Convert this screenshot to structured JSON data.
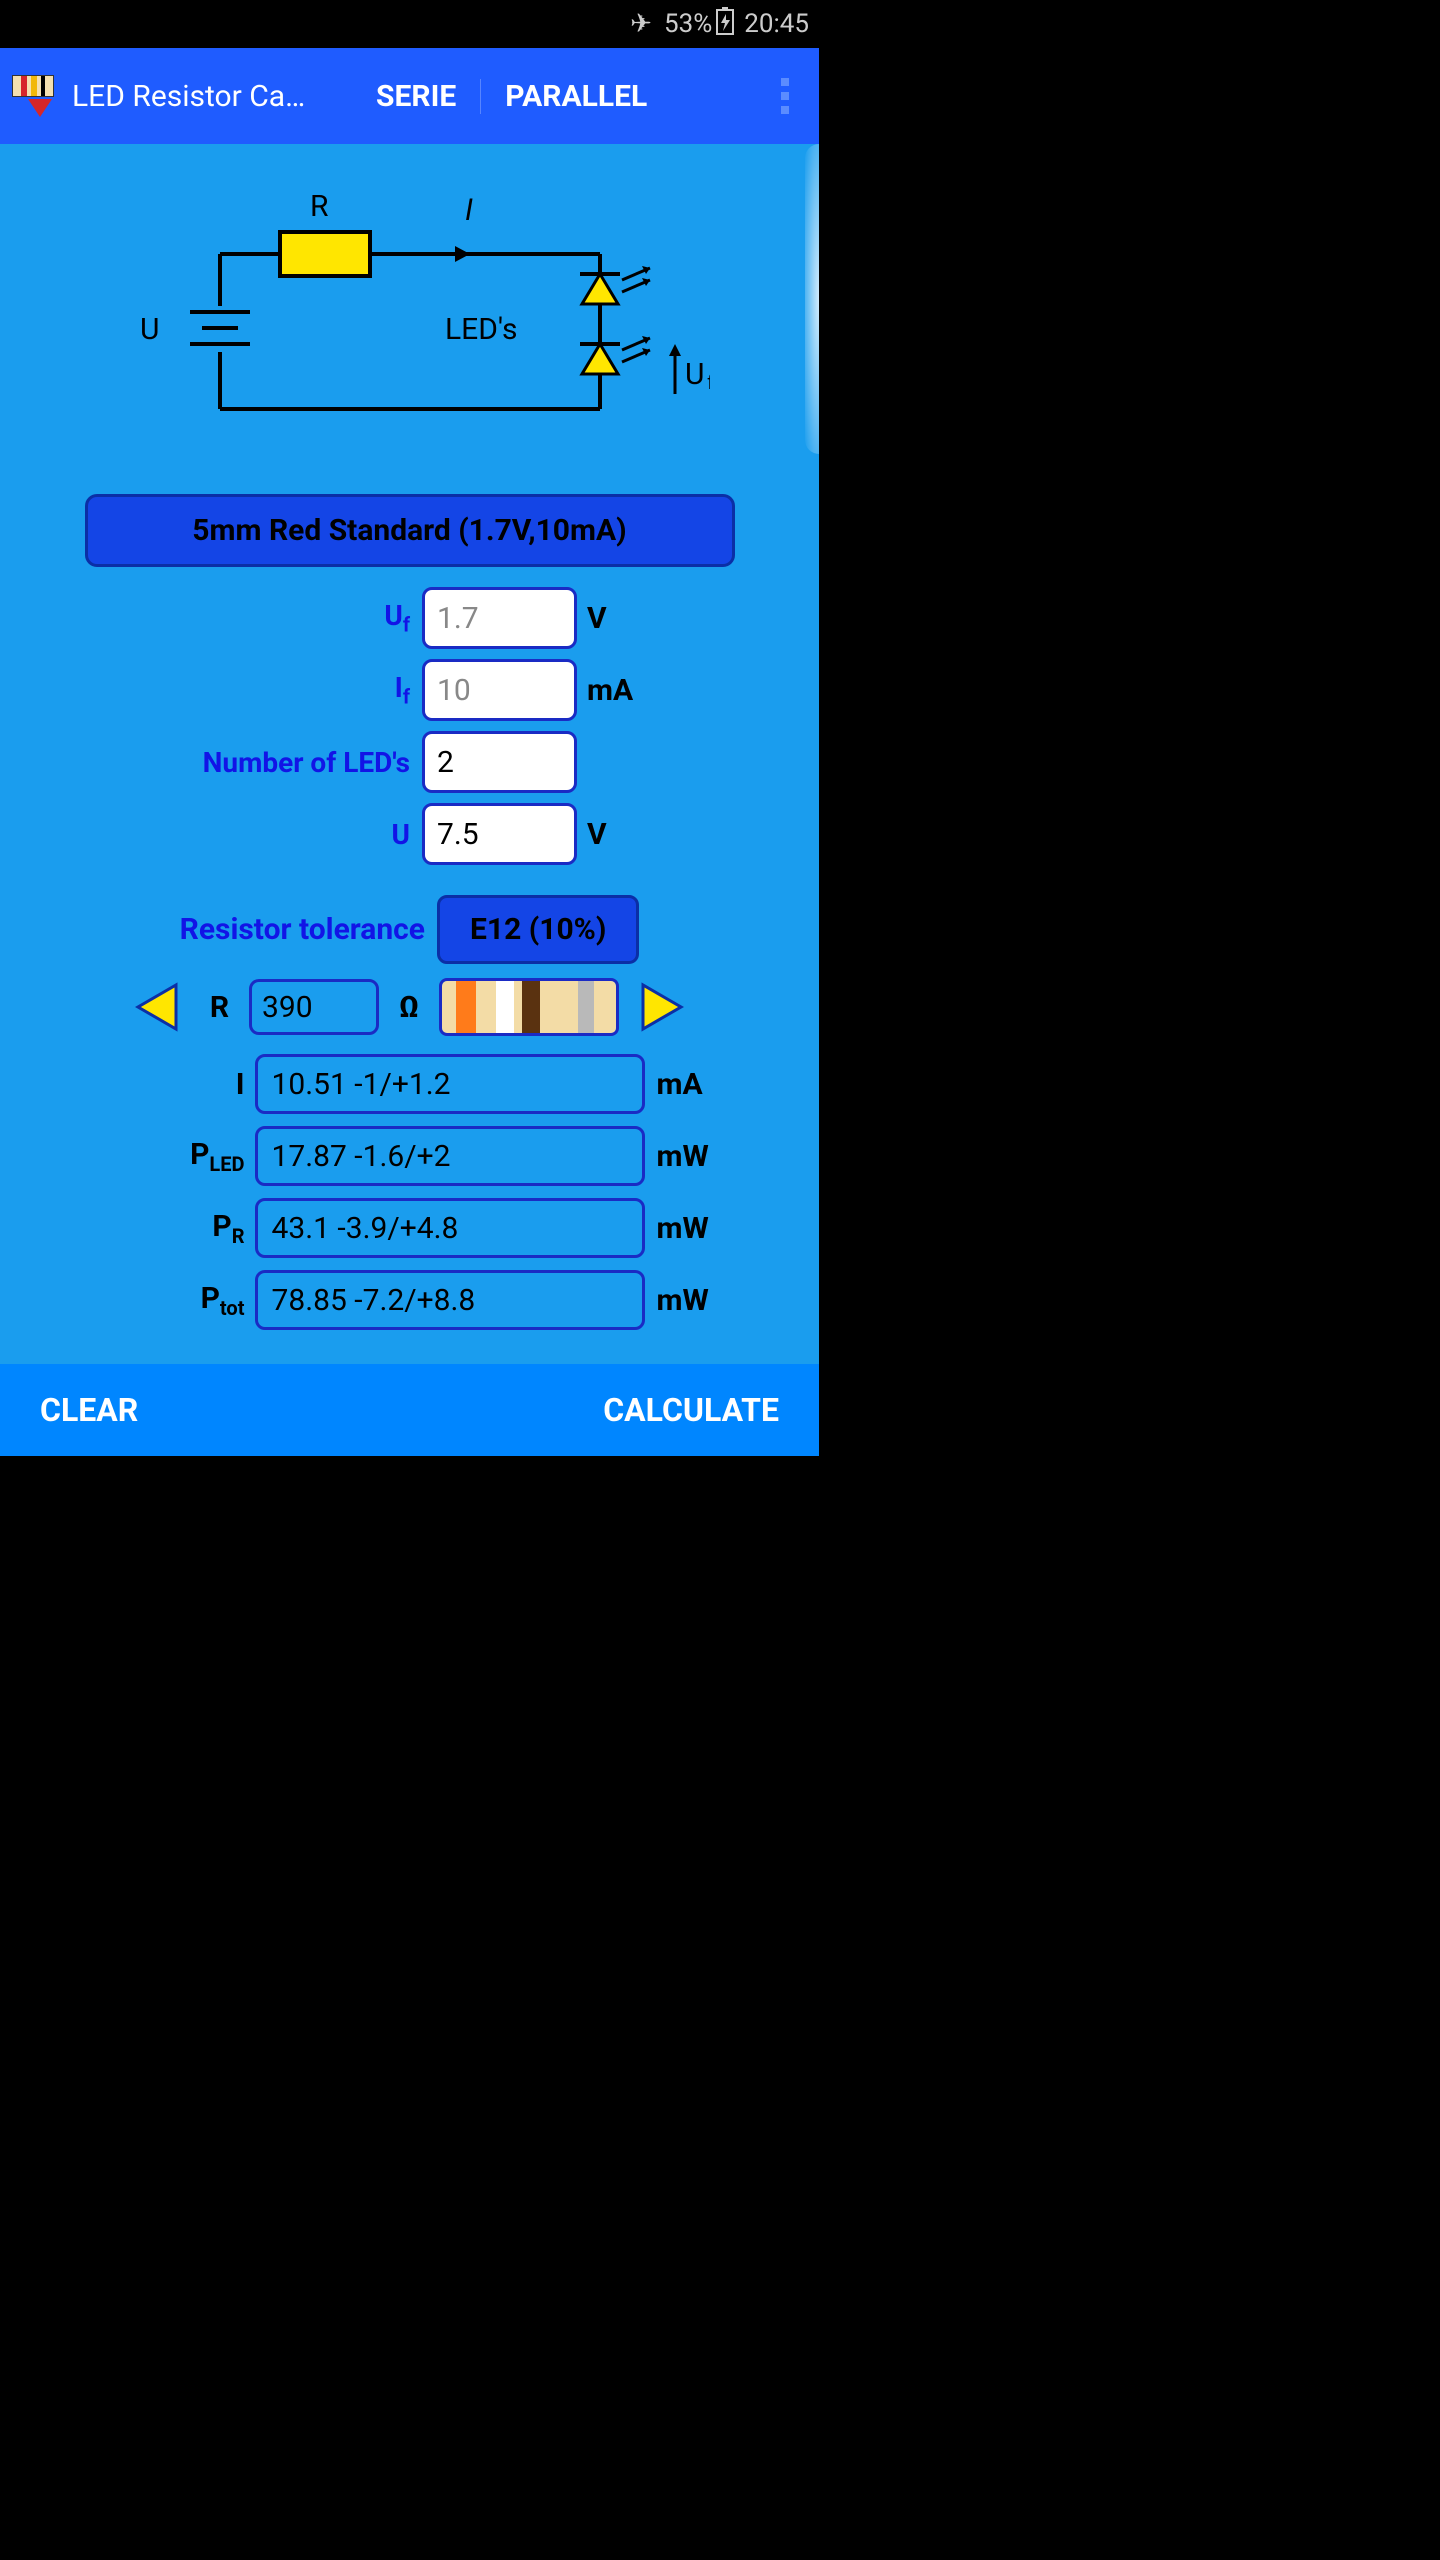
{
  "status": {
    "battery_percent": "53%",
    "time": "20:45"
  },
  "header": {
    "app_title": "LED Resistor Ca…",
    "tabs": [
      "SERIE",
      "PARALLEL"
    ]
  },
  "diagram": {
    "U_label": "U",
    "R_label": "R",
    "I_label": "I",
    "leds_label": "LED's",
    "Uf_label": "Uf"
  },
  "led_type_button": "5mm Red Standard (1.7V,10mA)",
  "inputs": {
    "uf": {
      "label": "Uf",
      "value": "1.7",
      "unit": "V"
    },
    "if": {
      "label": "If",
      "value": "10",
      "unit": "mA"
    },
    "n_leds": {
      "label": "Number of LED's",
      "value": "2",
      "unit": ""
    },
    "u": {
      "label": "U",
      "value": "7.5",
      "unit": "V"
    }
  },
  "tolerance": {
    "label": "Resistor tolerance",
    "value": "E12 (10%)"
  },
  "resistor": {
    "label": "R",
    "value": "390",
    "unit": "Ω",
    "bands_name": "orange-white-brown-silver"
  },
  "outputs": {
    "i": {
      "label": "I",
      "value": "10.51  -1/+1.2",
      "unit": "mA"
    },
    "pled": {
      "label": "PLED",
      "value": "17.87  -1.6/+2",
      "unit": "mW"
    },
    "pr": {
      "label": "PR",
      "value": "43.1  -3.9/+4.8",
      "unit": "mW"
    },
    "ptot": {
      "label": "Ptot",
      "value": "78.85  -7.2/+8.8",
      "unit": "mW"
    }
  },
  "bottom": {
    "clear": "CLEAR",
    "calculate": "CALCULATE"
  }
}
